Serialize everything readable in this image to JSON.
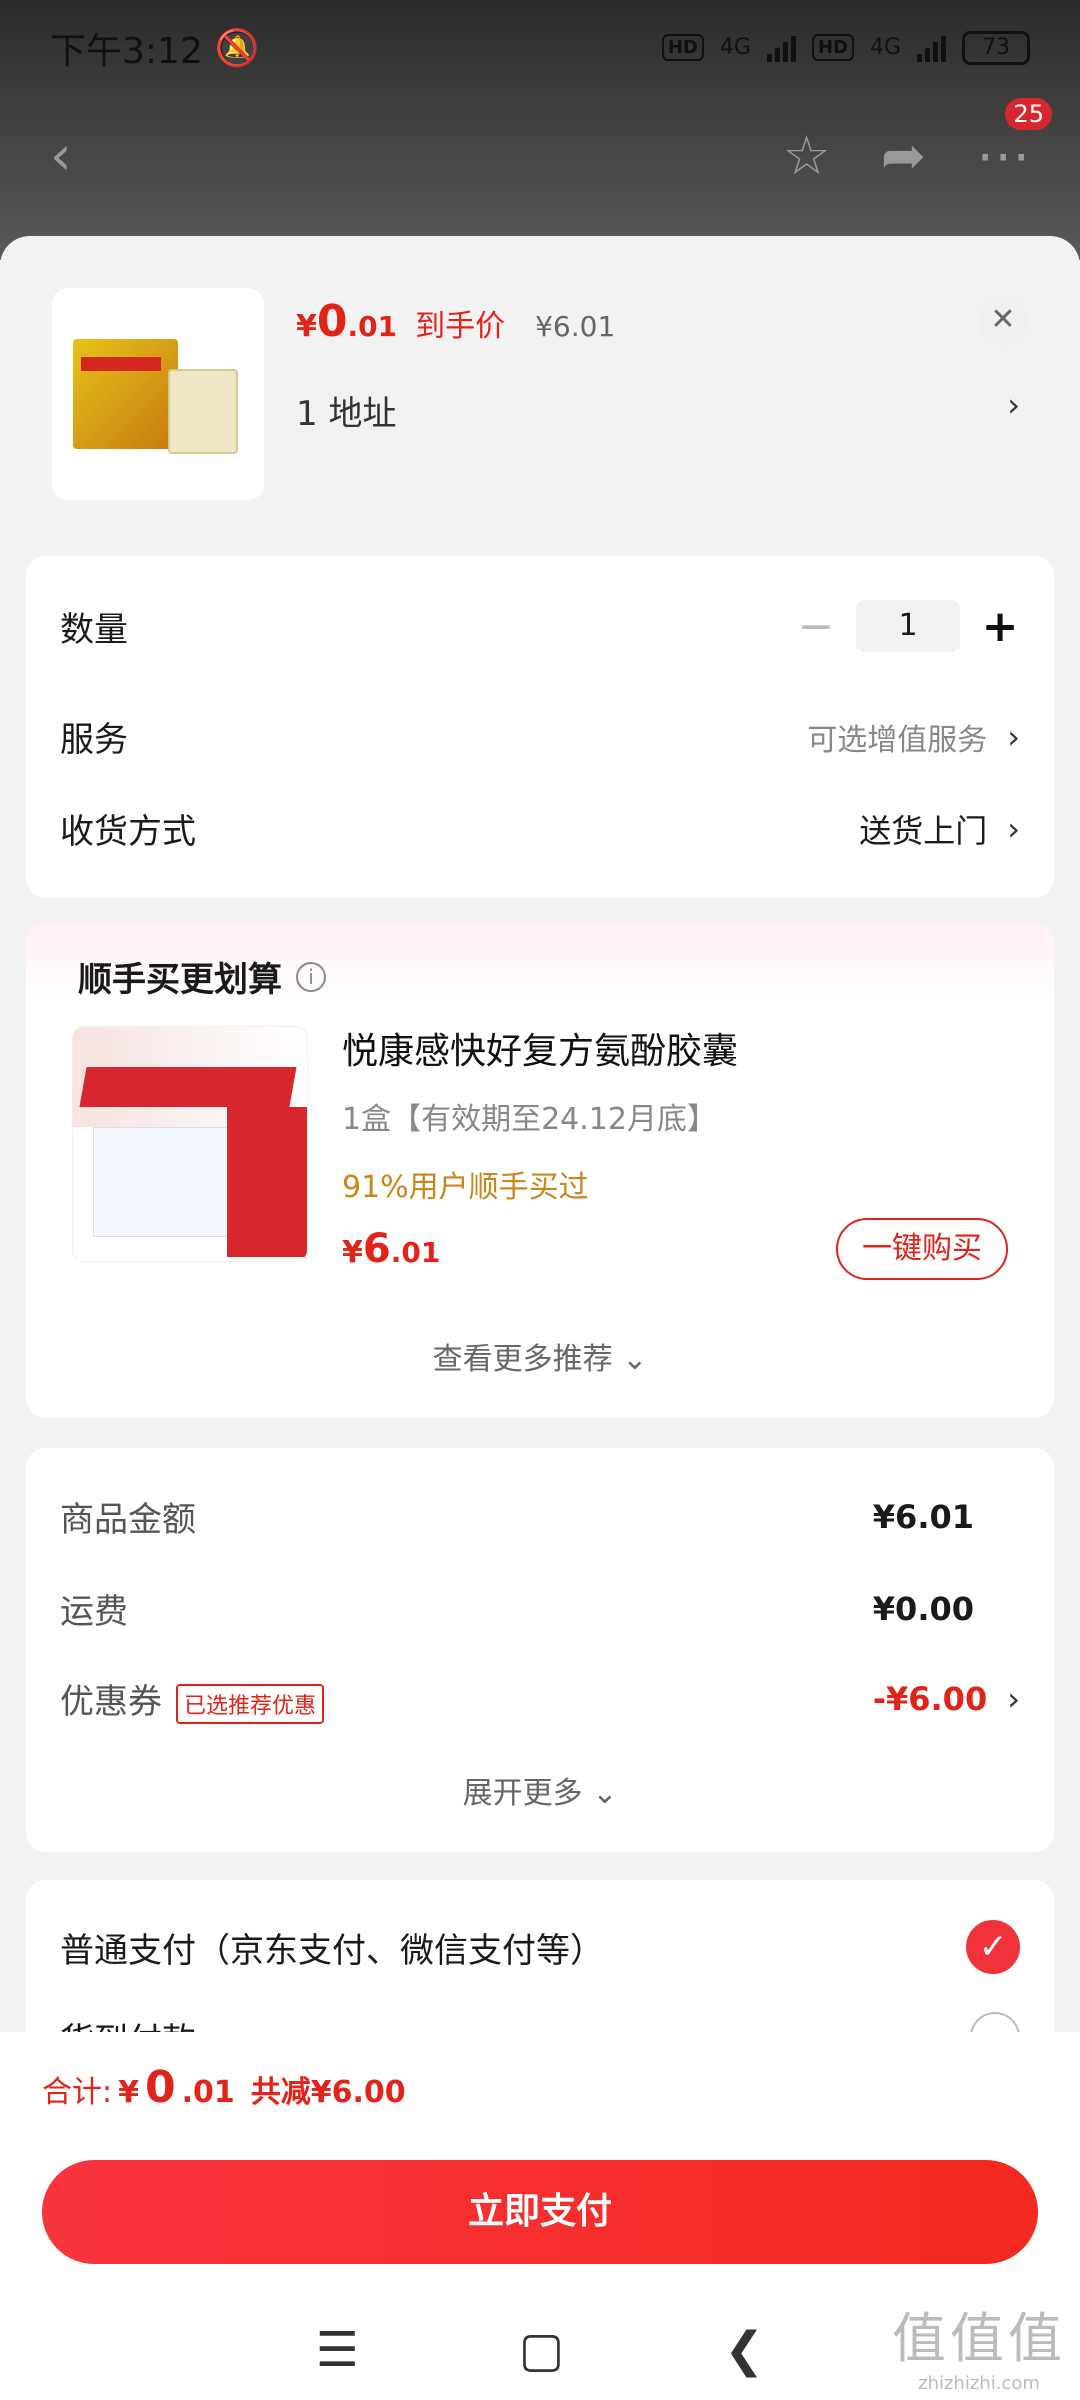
{
  "status_bar": {
    "time": "下午3:12",
    "hd1": "HD",
    "net1": "4G",
    "hd2": "HD",
    "net2": "4G",
    "battery": "73"
  },
  "bg_nav": {
    "badge": "25"
  },
  "product": {
    "price_symbol": "¥",
    "price_int": "0",
    "price_dec": ".01",
    "final_label": "到手价",
    "original_price": "¥6.01",
    "address": "1  地址",
    "address_chevron": "›",
    "close": "✕"
  },
  "options": {
    "quantity_label": "数量",
    "quantity_value": "1",
    "minus": "−",
    "plus": "+",
    "service_label": "服务",
    "service_value": "可选增值服务",
    "delivery_label": "收货方式",
    "delivery_value": "送货上门",
    "chevron": "›"
  },
  "recommend": {
    "title": "顺手买更划算",
    "info": "i",
    "name": "悦康感快好复方氨酚胶囊",
    "spec": "1盒【有效期至24.12月底】",
    "tip": "91%用户顺手买过",
    "price_symbol": "¥",
    "price_int": "6",
    "price_dec": ".01",
    "buy_label": "一键购买",
    "more": "查看更多推荐 ⌄"
  },
  "summary": {
    "goods_label": "商品金额",
    "goods_value": "¥6.01",
    "shipping_label": "运费",
    "shipping_value": "¥0.00",
    "coupon_label": "优惠券",
    "coupon_tag": "已选推荐优惠",
    "coupon_value": "-¥6.00",
    "expand": "展开更多 ⌄"
  },
  "payment": {
    "option1": "普通支付（京东支付、微信支付等）",
    "option2": "货到付款",
    "check": "✓"
  },
  "bottom": {
    "total_label": "合计:",
    "symbol": "¥",
    "int": "0",
    "dec": ".01",
    "saved": "共减¥6.00",
    "pay_button": "立即支付"
  },
  "sys_nav": {
    "menu": "☰",
    "home": "▢",
    "back": "❮"
  },
  "watermark": {
    "logo": "值值值",
    "url": "zhizhizhi.com"
  },
  "colors": {
    "accent": "#e2231a",
    "tip": "#c9861b",
    "background": "#f2f2f2"
  }
}
